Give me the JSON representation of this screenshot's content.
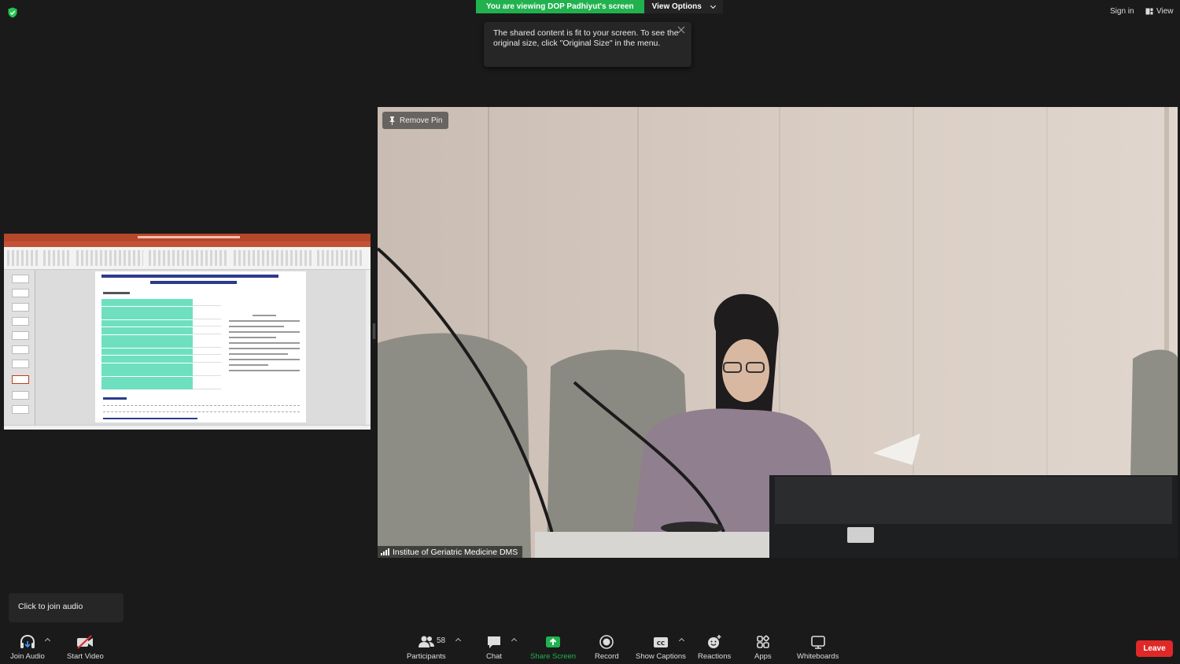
{
  "banner": {
    "viewing_text": "You are viewing DOP Padhiyut's screen",
    "view_options": "View Options"
  },
  "tooltip": {
    "message": "The shared content is fit to your screen. To see the original size, click \"Original Size\" in the menu."
  },
  "topbar": {
    "sign_in": "Sign in",
    "view": "View"
  },
  "video": {
    "remove_pin": "Remove Pin",
    "participant_name": "Institue of Geriatric Medicine DMS"
  },
  "audio_popup": {
    "text": "Click to join audio"
  },
  "toolbar": {
    "join_audio": "Join Audio",
    "start_video": "Start Video",
    "participants": "Participants",
    "participants_count": "58",
    "chat": "Chat",
    "share_screen": "Share Screen",
    "record": "Record",
    "show_captions": "Show Captions",
    "reactions": "Reactions",
    "apps": "Apps",
    "whiteboards": "Whiteboards",
    "leave": "Leave"
  },
  "colors": {
    "banner_green": "#21b24f",
    "share_green": "#21b24f",
    "leave_red": "#e02828",
    "background": "#1a1a1a"
  }
}
